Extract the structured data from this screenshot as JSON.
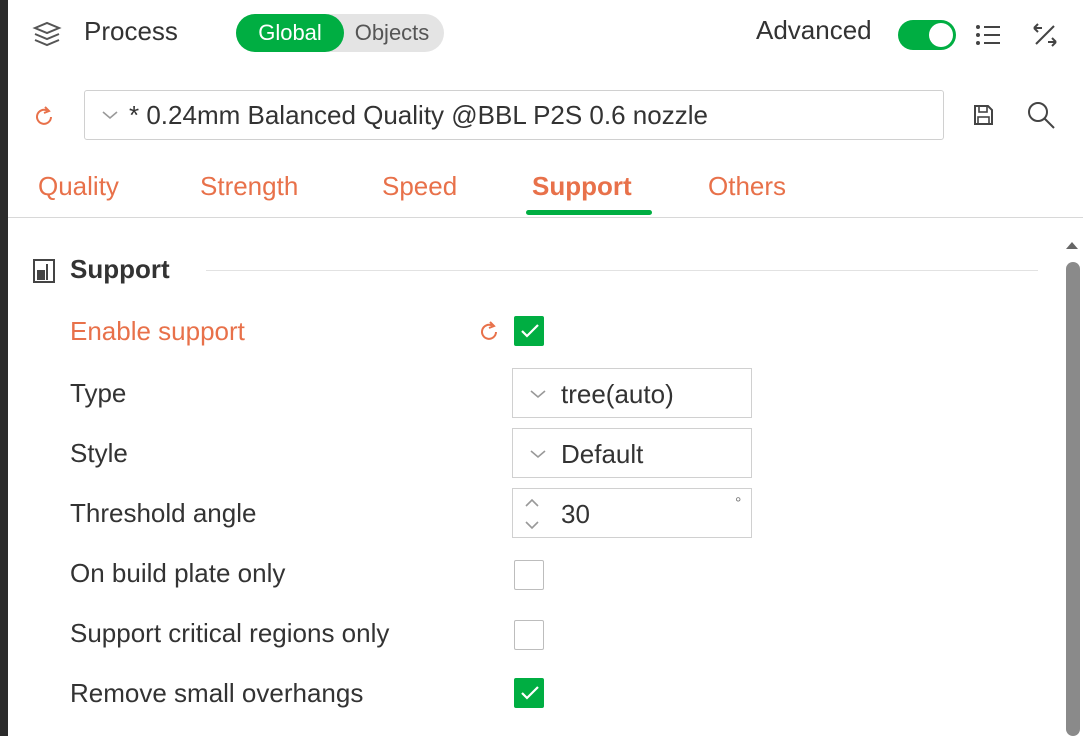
{
  "header": {
    "title": "Process",
    "scope": {
      "global_label": "Global",
      "objects_label": "Objects",
      "selected": "Global"
    },
    "advanced_label": "Advanced",
    "advanced_on": true
  },
  "preset": {
    "name": "* 0.24mm Balanced Quality @BBL P2S 0.6 nozzle"
  },
  "tabs": [
    {
      "label": "Quality",
      "active": false
    },
    {
      "label": "Strength",
      "active": false
    },
    {
      "label": "Speed",
      "active": false
    },
    {
      "label": "Support",
      "active": true
    },
    {
      "label": "Others",
      "active": false
    }
  ],
  "section": {
    "title": "Support",
    "options": {
      "enable_support": {
        "label": "Enable support",
        "checked": true,
        "modified": true
      },
      "type": {
        "label": "Type",
        "value": "tree(auto)"
      },
      "style": {
        "label": "Style",
        "value": "Default"
      },
      "threshold_angle": {
        "label": "Threshold angle",
        "value": "30",
        "unit": "°"
      },
      "build_plate_only": {
        "label": "On build plate only",
        "checked": false
      },
      "critical_regions_only": {
        "label": "Support critical regions only",
        "checked": false
      },
      "remove_small_overhangs": {
        "label": "Remove small overhangs",
        "checked": true
      }
    }
  },
  "icons": {
    "process": "layers-icon",
    "list": "list-icon",
    "compare": "compare-icon",
    "reset": "reset-arrow-icon",
    "save": "save-icon",
    "search": "search-icon",
    "section": "support-icon"
  },
  "colors": {
    "accent_green": "#00ae42",
    "modified_orange": "#e8714a",
    "text": "#333333",
    "border": "#d0d0d0"
  }
}
